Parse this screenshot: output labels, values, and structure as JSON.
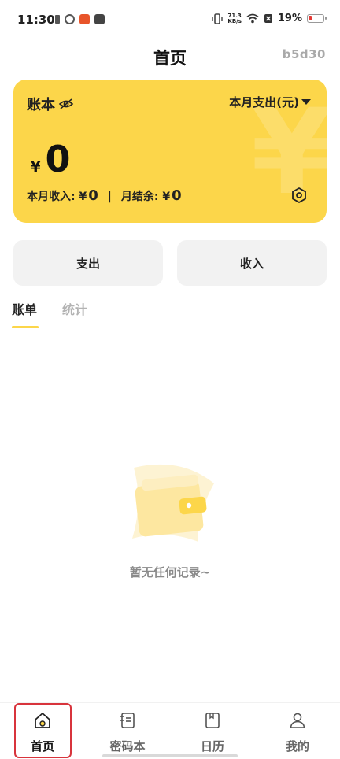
{
  "status_bar": {
    "time": "11:30",
    "net_speed_value": "71.3",
    "net_speed_unit": "KB/s",
    "battery": "19%",
    "icons": [
      "sim-icon",
      "app-icon",
      "notification-icon",
      "bag-icon",
      "vibrate-icon",
      "wifi-icon",
      "no-sim-icon",
      "battery-icon"
    ]
  },
  "header": {
    "title": "首页",
    "user": "b5d30"
  },
  "card": {
    "title": "账本",
    "eye_icon": "eye-off-icon",
    "period": "本月支出(元)",
    "currency": "¥",
    "amount": "0",
    "income_label": "本月收入: ¥",
    "income_value": "0",
    "separator": "|",
    "balance_label": "月结余: ¥",
    "balance_value": "0",
    "bg_color": "#fcd64a"
  },
  "actions": {
    "expense": "支出",
    "income": "收入"
  },
  "tabs": [
    {
      "label": "账单",
      "active": true
    },
    {
      "label": "统计",
      "active": false
    }
  ],
  "empty": {
    "text": "暂无任何记录~"
  },
  "bottom_nav": [
    {
      "label": "首页",
      "icon": "home-icon",
      "active": true
    },
    {
      "label": "密码本",
      "icon": "password-book-icon",
      "active": false
    },
    {
      "label": "日历",
      "icon": "calendar-icon",
      "active": false
    },
    {
      "label": "我的",
      "icon": "profile-icon",
      "active": false
    }
  ],
  "colors": {
    "accent": "#fcd64a",
    "highlight": "#d8343c"
  }
}
